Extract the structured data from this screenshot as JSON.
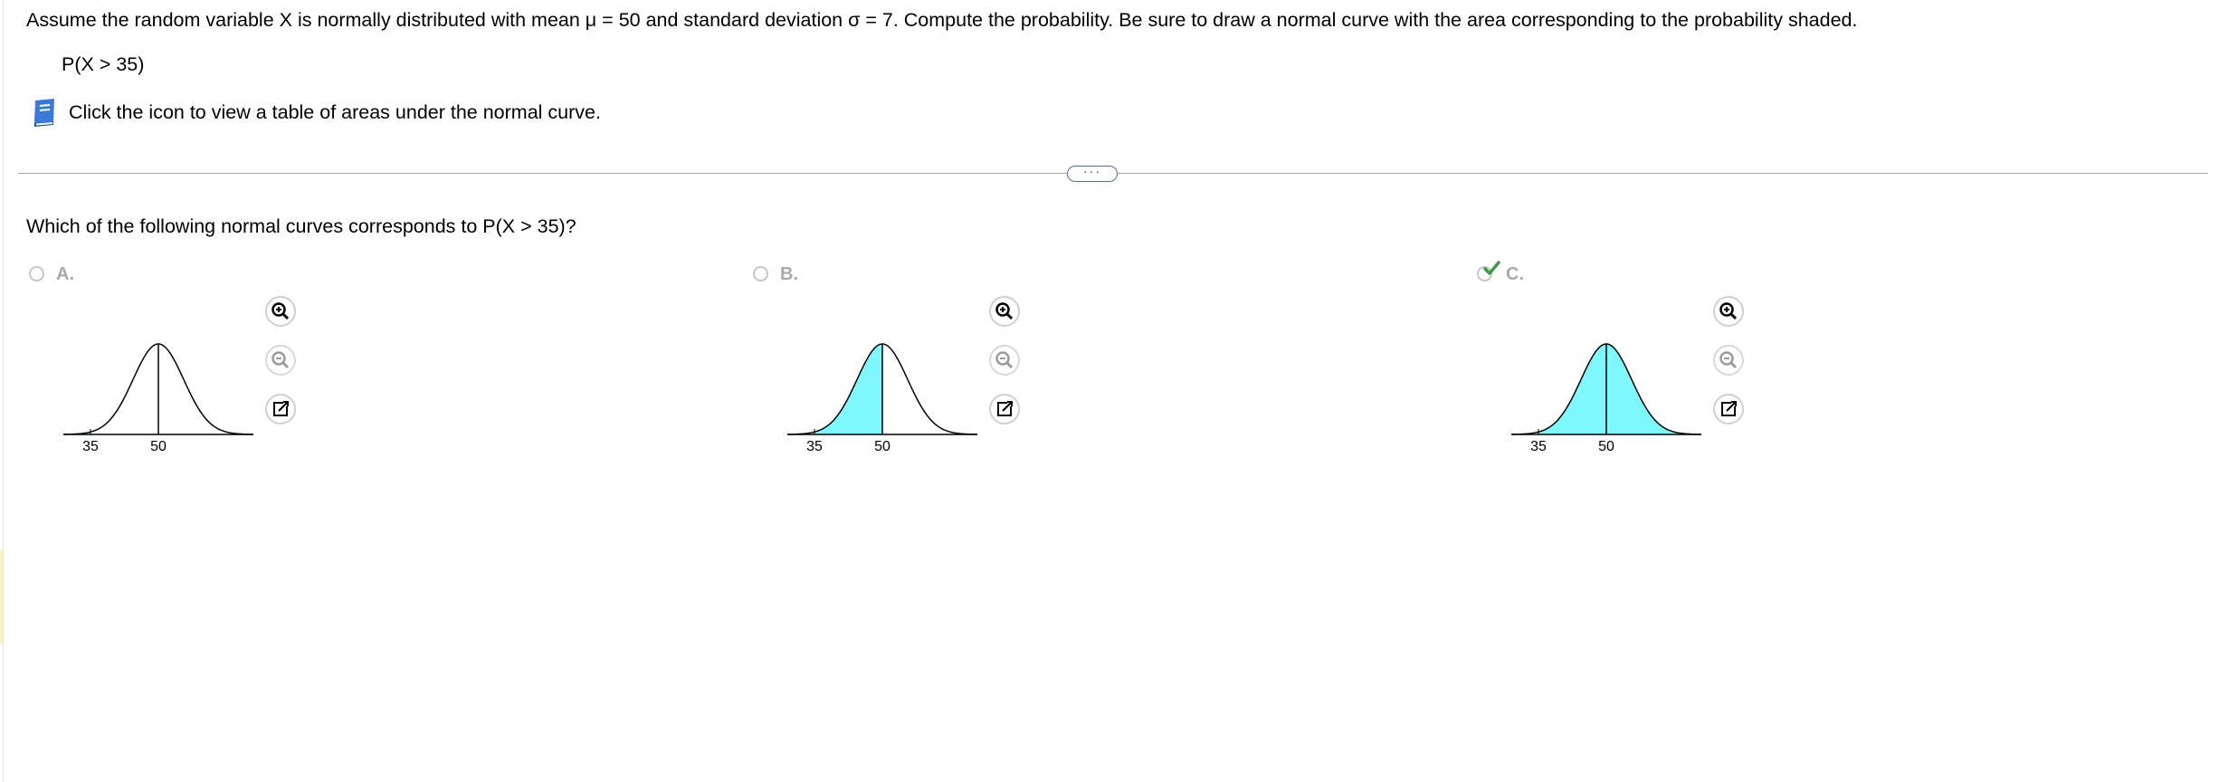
{
  "question": {
    "text": "Assume the random variable X is normally distributed with mean μ = 50 and standard deviation σ = 7. Compute the probability. Be sure to draw a normal curve with the area corresponding to the probability shaded.",
    "expression": "P(X > 35)",
    "table_link": "Click the icon to view a table of areas under the normal curve."
  },
  "more_button": {
    "label": "···"
  },
  "sub_question": "Which of the following normal curves corresponds to P(X > 35)?",
  "options": [
    {
      "letter": "A.",
      "selected": false,
      "tick_left": "35",
      "tick_mean": "50",
      "shaded": "left-tail"
    },
    {
      "letter": "B.",
      "selected": false,
      "tick_left": "35",
      "tick_mean": "50",
      "shaded": "between"
    },
    {
      "letter": "C.",
      "selected": true,
      "tick_left": "35",
      "tick_mean": "50",
      "shaded": "right-of-35"
    }
  ],
  "icons": {
    "book": "book-icon",
    "zoom_in": "zoom-in-icon",
    "zoom_out": "zoom-out-icon",
    "popout": "popout-icon",
    "check": "checkmark-icon"
  },
  "colors": {
    "shade": "#7ff8fb",
    "check": "#3e9a47",
    "divider": "#a8a8a8",
    "book": "#3c78d8"
  }
}
